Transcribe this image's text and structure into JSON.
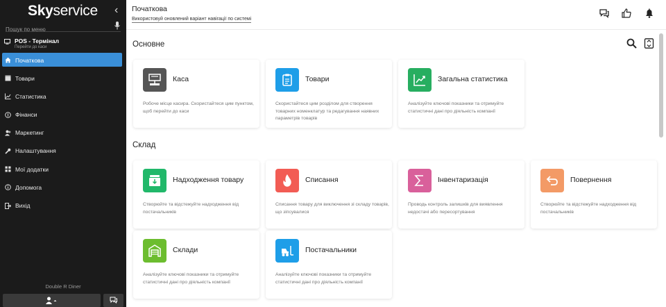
{
  "app": {
    "logo_bold": "Sky",
    "logo_rest": "service"
  },
  "sidebar": {
    "search_placeholder": "Пошук по меню",
    "pos": {
      "title": "POS - Термінал",
      "subtitle": "Перейти до каси"
    },
    "items": [
      {
        "label": "Початкова",
        "icon": "home-icon",
        "active": true
      },
      {
        "label": "Товари",
        "icon": "box-icon"
      },
      {
        "label": "Статистика",
        "icon": "chart-icon"
      },
      {
        "label": "Фінанси",
        "icon": "coin-icon"
      },
      {
        "label": "Маркетинг",
        "icon": "users-icon"
      },
      {
        "label": "Налаштування",
        "icon": "wrench-icon"
      },
      {
        "label": "Мої додатки",
        "icon": "grid-icon"
      },
      {
        "label": "Допомога",
        "icon": "info-icon"
      },
      {
        "label": "Вихід",
        "icon": "exit-icon"
      }
    ],
    "footer_name": "Double R Diner"
  },
  "header": {
    "title": "Початкова",
    "nav_hint": "Використовуй оновлений варіант навігації по системі"
  },
  "sections": {
    "main": {
      "title": "Основне",
      "cards": [
        {
          "title": "Каса",
          "desc": "Робоче місце касира. Скористайтеся цим пунктом, щоб перейти до каси",
          "color": "#555555",
          "icon": "register-icon"
        },
        {
          "title": "Товари",
          "desc": "Скористайтеся цим розділом для створення товарних номенклатур та редагування наявних параметрів товарів",
          "color": "#1e9ee8",
          "icon": "clipboard-icon"
        },
        {
          "title": "Загальна статистика",
          "desc": "Аналізуйте ключові показники та отримуйте статистичні дані про діяльність компанії",
          "color": "#27ae60",
          "icon": "trend-icon"
        }
      ]
    },
    "warehouse": {
      "title": "Склад",
      "cards": [
        {
          "title": "Надходження товару",
          "desc": "Створюйте та відстежуйте надходження від постачальників",
          "color": "#21b86a",
          "icon": "inbox-icon"
        },
        {
          "title": "Списання",
          "desc": "Списання товару для виключення зі складу товарів, що зіпсувалися",
          "color": "#f25c54",
          "icon": "fire-icon"
        },
        {
          "title": "Інвентаризація",
          "desc": "Проводь контроль залишків для виявлення недостачі або пересортування",
          "color": "#d9609b",
          "icon": "sigma-icon"
        },
        {
          "title": "Повернення",
          "desc": "Створюйте та відстежуйте надходження від постачальників",
          "color": "#f39a66",
          "icon": "return-icon"
        },
        {
          "title": "Склади",
          "desc": "Аналізуйте ключові показники та отримуйте статистичні дані про діяльність компанії",
          "color": "#6cbd2f",
          "icon": "warehouse-icon"
        },
        {
          "title": "Постачальники",
          "desc": "Аналізуйте ключові показники та отримуйте статистичні дані про діяльність компанії",
          "color": "#1e9ee8",
          "icon": "forklift-icon"
        }
      ]
    }
  }
}
